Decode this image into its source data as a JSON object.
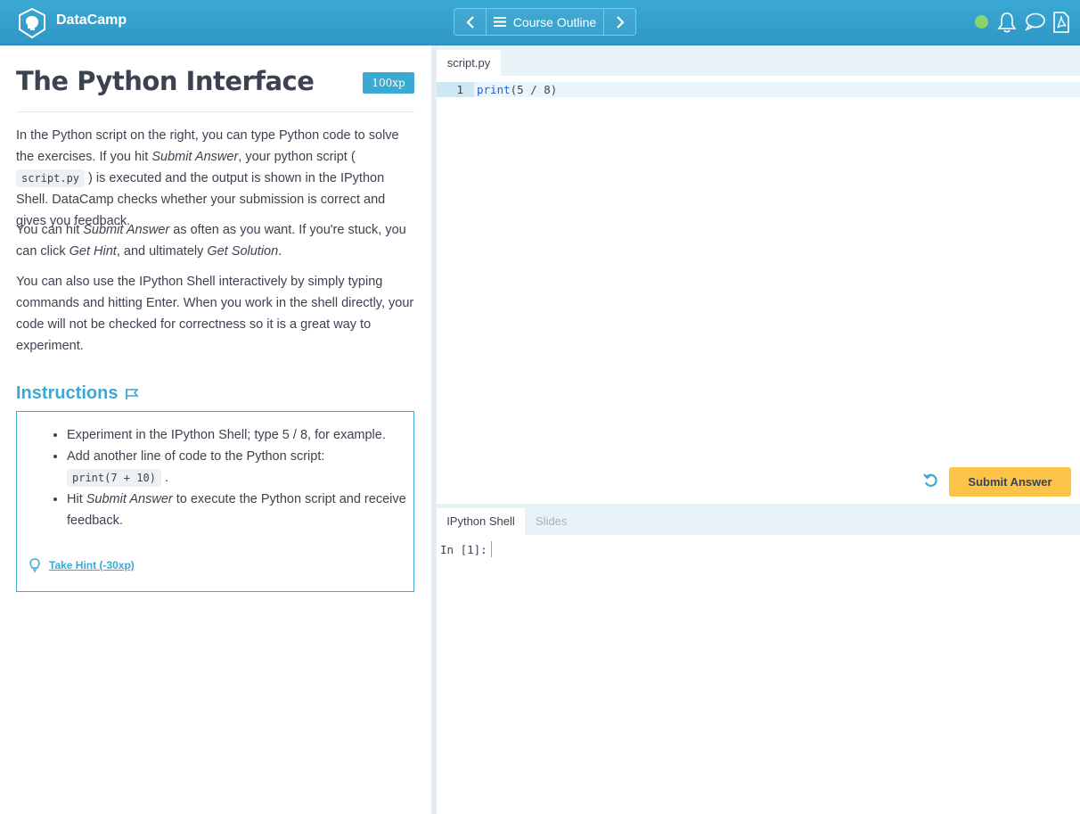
{
  "header": {
    "brand": "DataCamp",
    "outline_label": "Course Outline"
  },
  "exercise": {
    "title": "The Python Interface",
    "xp": "100xp",
    "p1_a": "In the Python script on the right, you can type Python code to solve the exercises. If you hit ",
    "p1_em": "Submit Answer",
    "p1_b": ", your python script ( ",
    "p1_code": "script.py",
    "p1_c": " ) is executed and the output is shown in the IPython Shell. DataCamp checks whether your submission is correct and gives you feedback.",
    "p2_a": "You can hit ",
    "p2_em1": "Submit Answer",
    "p2_b": " as often as you want. If you're stuck, you can click ",
    "p2_em2": "Get Hint",
    "p2_c": ", and ultimately ",
    "p2_em3": "Get Solution",
    "p2_d": ".",
    "p3": "You can also use the IPython Shell interactively by simply typing commands and hitting Enter. When you work in the shell directly, your code will not be checked for correctness so it is a great way to experiment."
  },
  "instructions": {
    "heading": "Instructions",
    "item1": "Experiment in the IPython Shell; type 5 / 8, for example.",
    "item2_text": "Add another line of code to the Python script: ",
    "item2_code": "print(7 + 10)",
    "item2_end": " .",
    "item3_a": "Hit ",
    "item3_em": "Submit Answer",
    "item3_b": " to execute the Python script and receive feedback.",
    "hint": "Take Hint (-30xp)"
  },
  "editor": {
    "tab": "script.py",
    "line_number": "1",
    "code_fn": "print",
    "code_rest": "(5 / 8)",
    "submit_label": "Submit Answer"
  },
  "shell": {
    "tab_active": "IPython Shell",
    "tab_other": "Slides",
    "prompt": "In [1]:"
  },
  "colors": {
    "brand_blue": "#3aa9d3",
    "submit_yellow": "#fbc348",
    "status_green": "#8bd36b"
  }
}
